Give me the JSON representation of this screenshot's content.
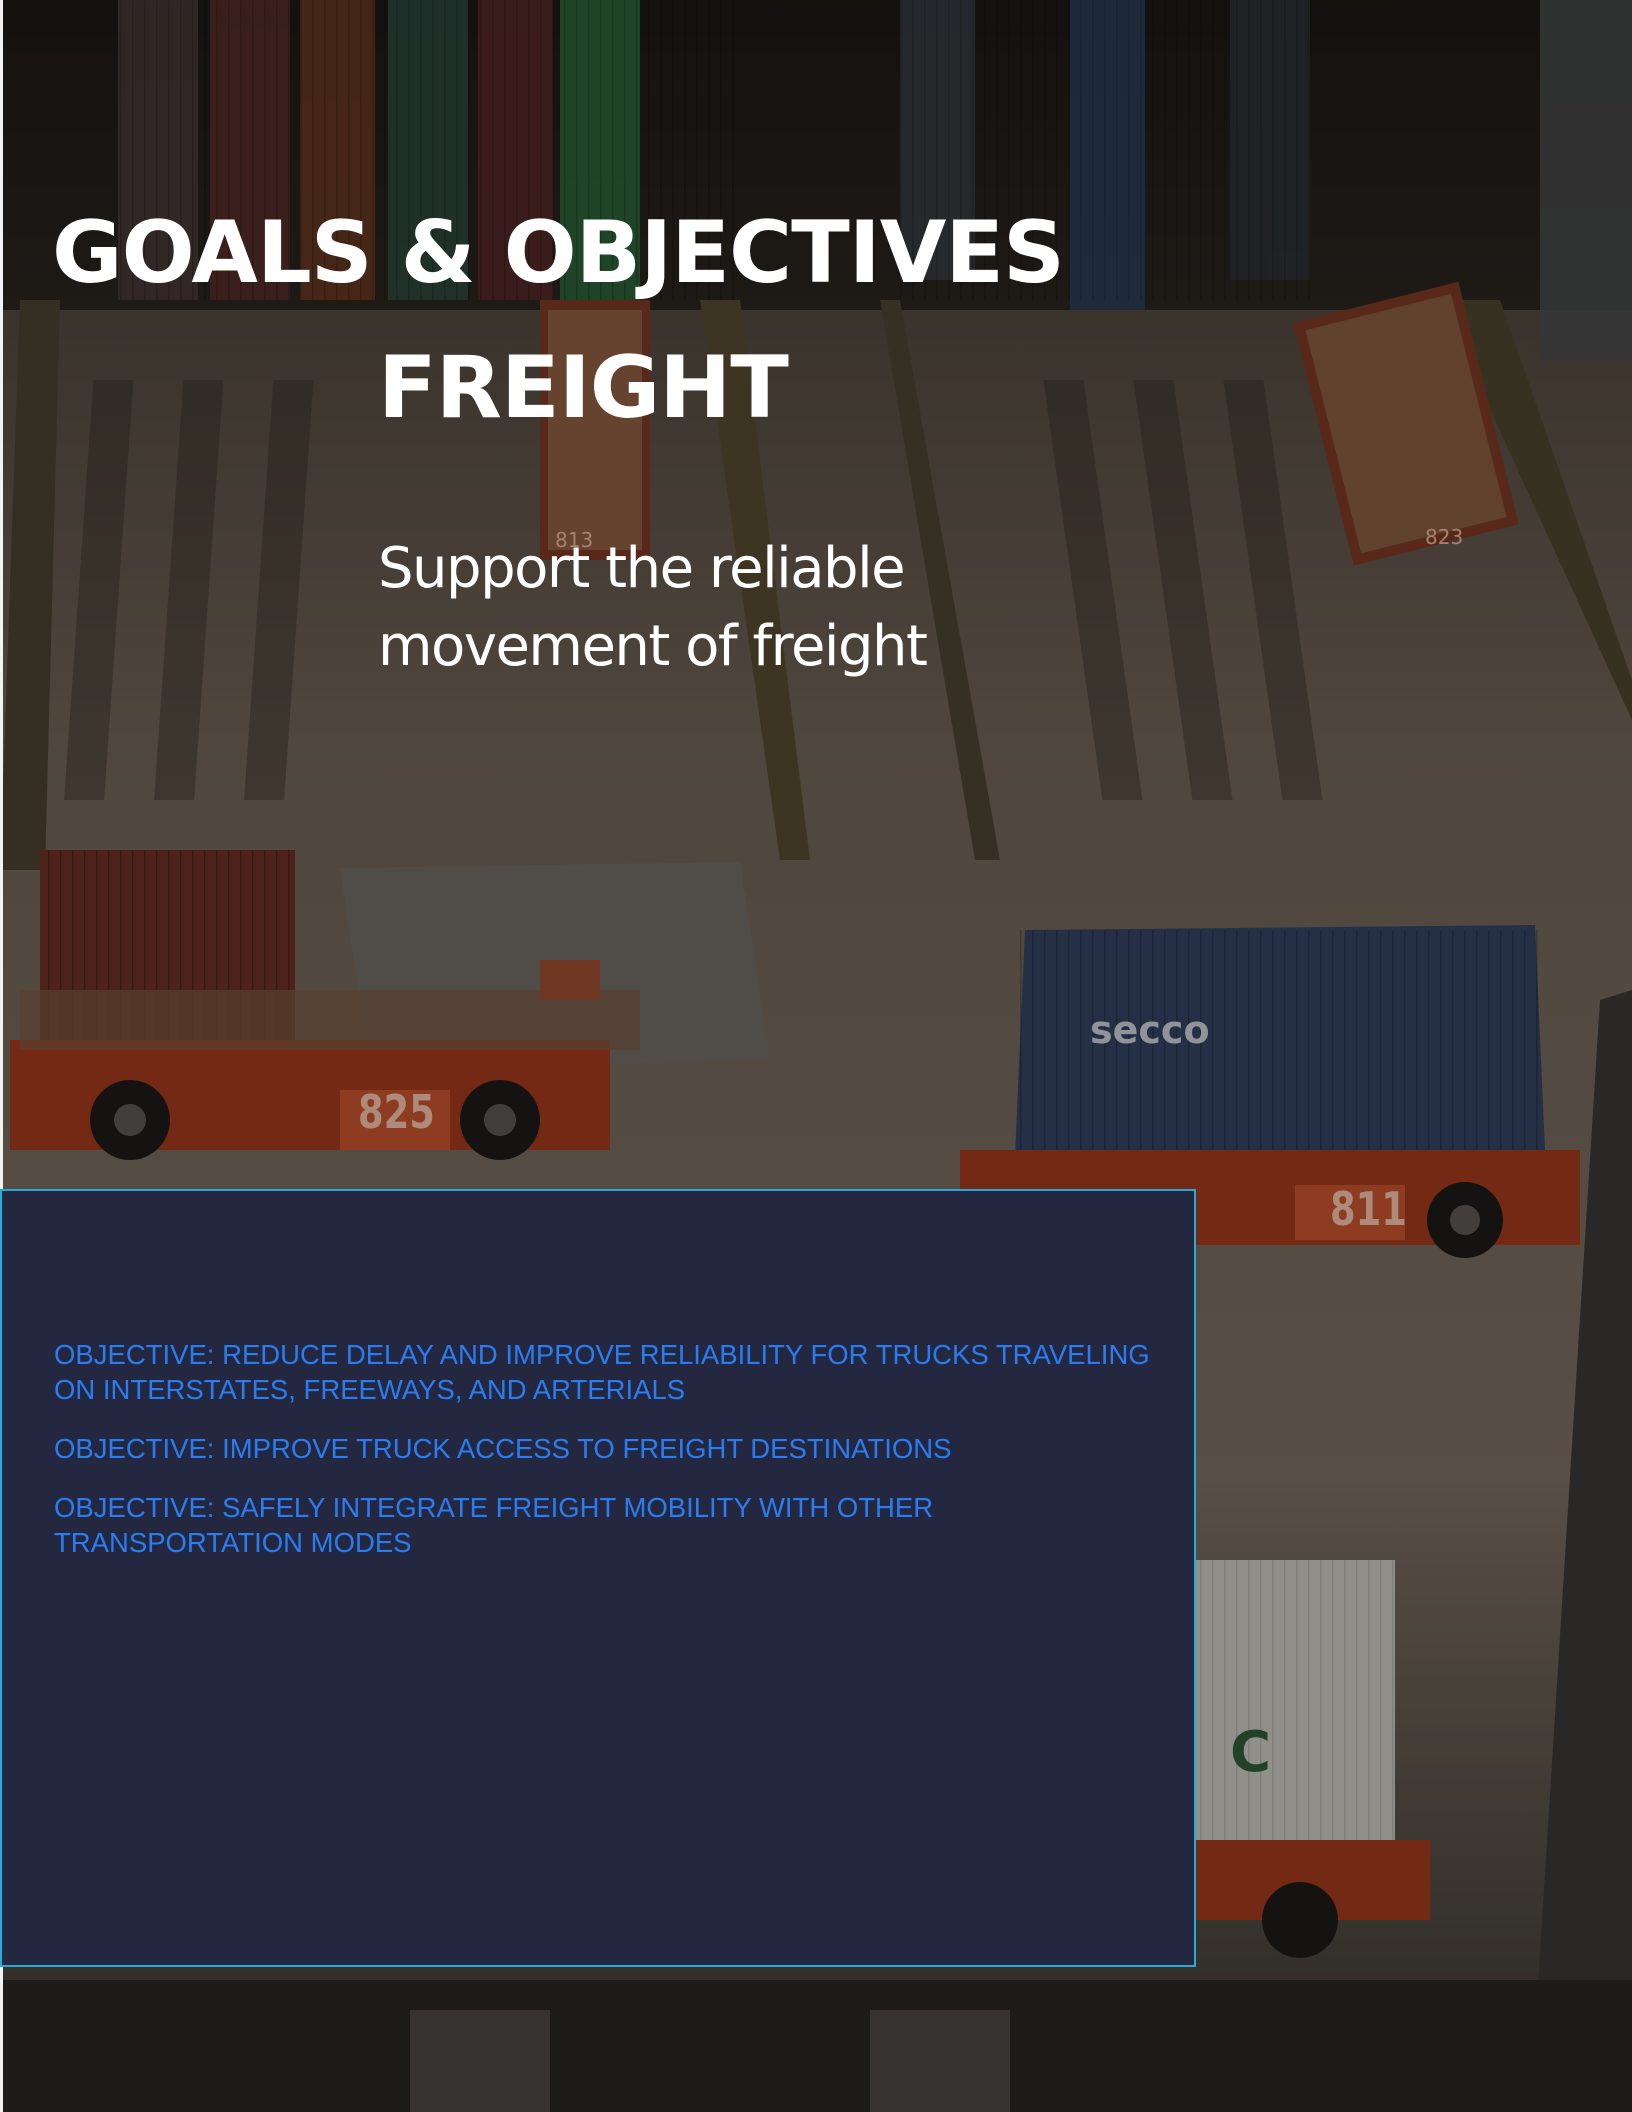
{
  "page": {
    "heading": "GOALS & OBJECTIVES",
    "section": "FREIGHT",
    "goal": "Support the reliable movement of freight"
  },
  "objectives": [
    "OBJECTIVE: REDUCE DELAY AND IMPROVE RELIABILITY FOR TRUCKS TRAVELING ON INTERSTATES, FREEWAYS, AND ARTERIALS",
    "OBJECTIVE: IMPROVE TRUCK ACCESS TO FREIGHT DESTINATIONS",
    "OBJECTIVE: SAFELY INTEGRATE FREIGHT MOBILITY WITH OTHER TRANSPORTATION MODES"
  ],
  "photo": {
    "vehicle_numbers": [
      "813",
      "823",
      "825",
      "811"
    ],
    "container_brand": "secco",
    "container_letter": "C"
  },
  "colors": {
    "panel_background": "#232840",
    "panel_border": "#29a9d8",
    "objective_text": "#2b7cf0",
    "heading_text": "#ffffff"
  }
}
